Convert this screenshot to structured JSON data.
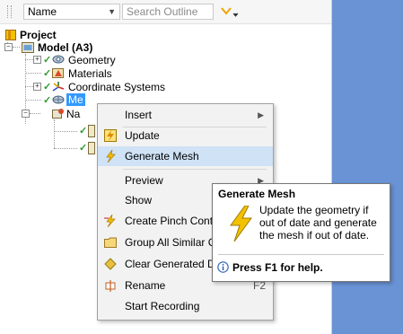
{
  "filter_bar": {
    "name_column": "Name",
    "search_placeholder": "Search Outline"
  },
  "tree": {
    "project": "Project",
    "model": "Model (A3)",
    "geometry": "Geometry",
    "materials": "Materials",
    "coordinate_systems": "Coordinate Systems",
    "mesh_partial": "Me",
    "named_partial": "Na"
  },
  "context_menu": {
    "items": [
      {
        "label": "Insert",
        "has_submenu": true
      },
      {
        "label": "Update"
      },
      {
        "label": "Generate Mesh",
        "highlighted": true
      },
      {
        "label": "Preview",
        "has_submenu": true
      },
      {
        "label": "Show"
      },
      {
        "label": "Create Pinch Contro"
      },
      {
        "label": "Group All Similar Ch"
      },
      {
        "label": "Clear Generated Dat"
      },
      {
        "label": "Rename",
        "shortcut": "F2"
      },
      {
        "label": "Start Recording"
      }
    ]
  },
  "tooltip": {
    "title": "Generate Mesh",
    "body": "Update the geometry if out of date and generate the mesh if out of date.",
    "help": "Press F1 for help."
  },
  "colors": {
    "panel_blue": "#6a93d6",
    "menu_highlight": "#cfe2f6",
    "checkmark_green": "#2e9b2e",
    "lightning_yellow": "#f2c200"
  }
}
